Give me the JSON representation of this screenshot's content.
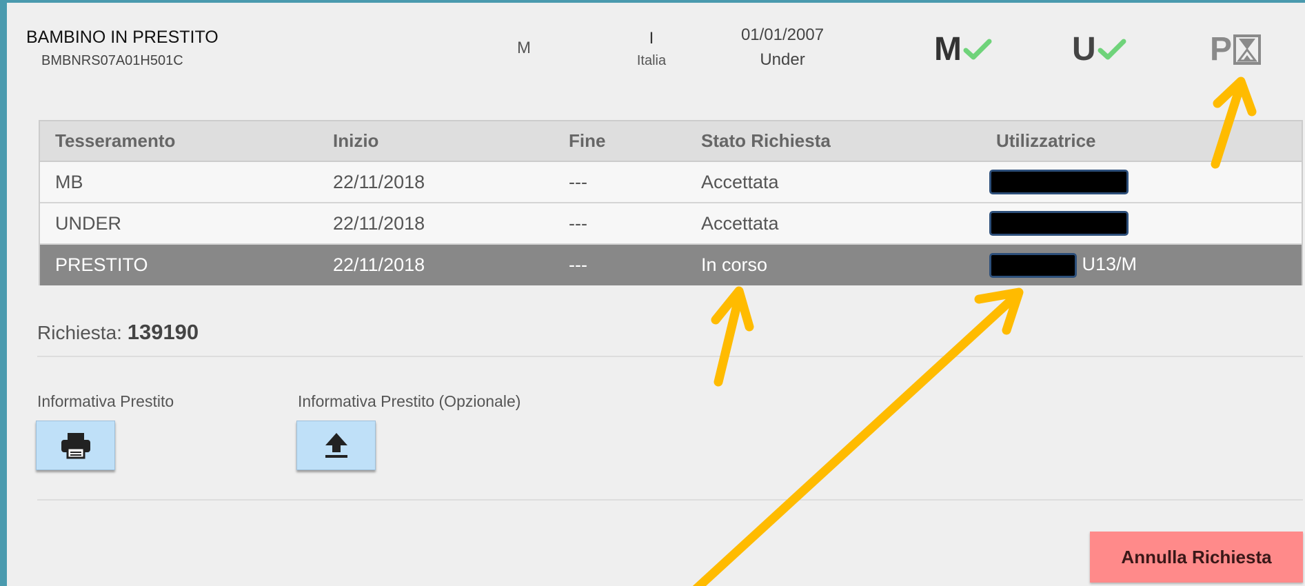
{
  "player": {
    "name": "BAMBINO IN PRESTITO",
    "code": "BMBNRS07A01H501C",
    "gender": "M",
    "nationality_code": "I",
    "nationality": "Italia",
    "birth_date": "01/01/2007",
    "category": "Under"
  },
  "badges": [
    {
      "letter": "M",
      "status": "check-icon"
    },
    {
      "letter": "U",
      "status": "check-icon"
    },
    {
      "letter": "P",
      "status": "hourglass-icon"
    }
  ],
  "colors": {
    "frame_border": "#4a9aae",
    "check": "#6fd37a",
    "selected_row": "#888888",
    "icon_button": "#bfe0f8",
    "cancel_button": "#ff8a8a",
    "annotation_arrow": "#ffbb00"
  },
  "table": {
    "headers": [
      "Tesseramento",
      "Inizio",
      "Fine",
      "Stato Richiesta",
      "Utilizzatrice"
    ],
    "rows": [
      {
        "tesseramento": "MB",
        "inizio": "22/11/2018",
        "fine": "---",
        "stato": "Accettata",
        "utilizzatrice_suffix": ""
      },
      {
        "tesseramento": "UNDER",
        "inizio": "22/11/2018",
        "fine": "---",
        "stato": "Accettata",
        "utilizzatrice_suffix": ""
      },
      {
        "tesseramento": "PRESTITO",
        "inizio": "22/11/2018",
        "fine": "---",
        "stato": "In corso",
        "utilizzatrice_suffix": "U13/M"
      }
    ]
  },
  "request": {
    "label": "Richiesta:",
    "number": "139190"
  },
  "documents": {
    "prestito_label": "Informativa Prestito",
    "prestito_icon": "printer-icon",
    "opzionale_label": "Informativa Prestito (Opzionale)",
    "opzionale_icon": "upload-icon"
  },
  "actions": {
    "cancel_label": "Annulla Richiesta"
  }
}
